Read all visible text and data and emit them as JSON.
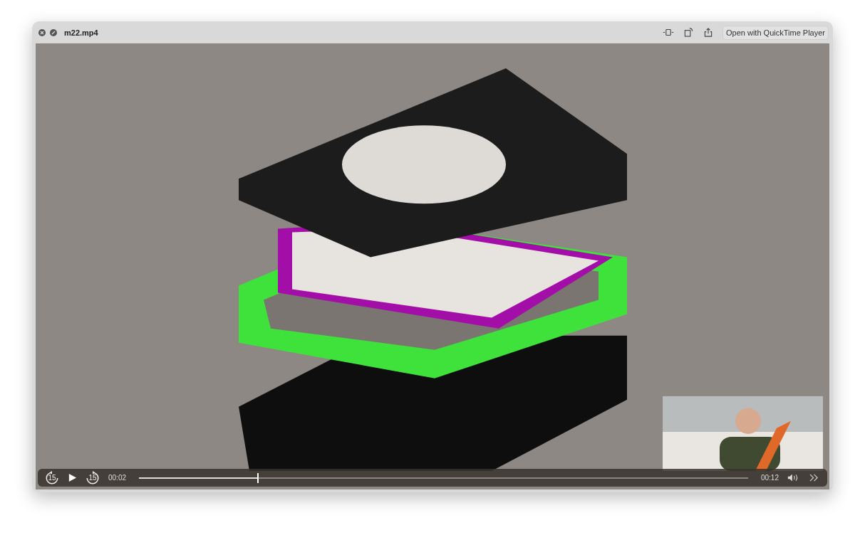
{
  "window": {
    "title": "m22.mp4"
  },
  "toolbar": {
    "open_button": "Open with QuickTime Player"
  },
  "controls": {
    "skip_back_label": "15",
    "skip_forward_label": "15",
    "playing": false,
    "elapsed": "00:02",
    "level": 0.195,
    "duration": "00:12"
  }
}
